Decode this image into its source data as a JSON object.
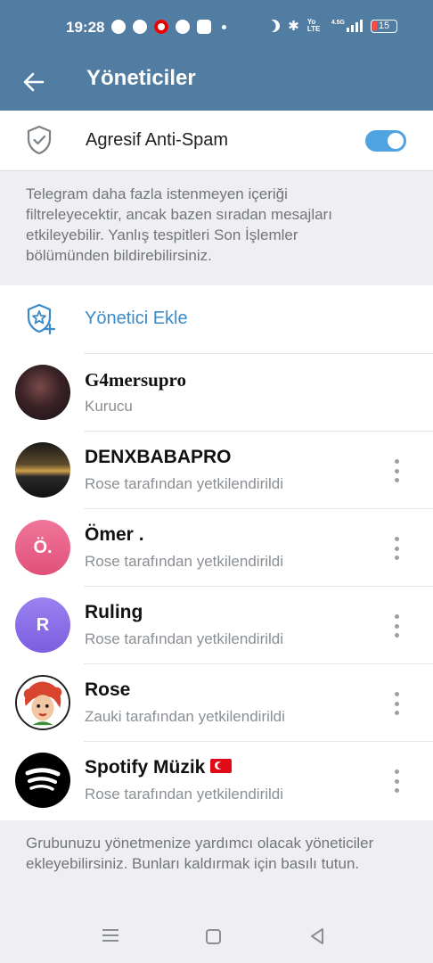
{
  "status_bar": {
    "time": "19:28",
    "network_label": "Yo LTE",
    "net_speed": "4.5G",
    "battery": "15"
  },
  "toolbar": {
    "title": "Yöneticiler"
  },
  "antispam": {
    "label": "Agresif Anti-Spam",
    "enabled": true,
    "description": "Telegram daha fazla istenmeyen içeriği filtreleyecektir, ancak bazen sıradan mesajları etkileyebilir. Yanlış tespitleri Son İşlemler bölümünden bildirebilirsiniz."
  },
  "add_admin": {
    "label": "Yönetici Ekle"
  },
  "admins": [
    {
      "name": "G4mersupro",
      "role": "Kurucu",
      "avatar": "photo-dark",
      "initial": ""
    },
    {
      "name": "DENXBABAPRO",
      "role": "Rose tarafından yetkilendirildi",
      "avatar": "photo-car",
      "initial": ""
    },
    {
      "name": "Ömer .",
      "role": "Rose tarafından yetkilendirildi",
      "avatar": "initial-pink",
      "initial": "Ö."
    },
    {
      "name": "Ruling",
      "role": "Rose tarafından yetkilendirildi",
      "avatar": "initial-purple",
      "initial": "R"
    },
    {
      "name": "Rose",
      "role": "Zauki tarafından yetkilendirildi",
      "avatar": "photo-redhead",
      "initial": ""
    },
    {
      "name": "Spotify Müzik",
      "role": "Rose tarafından yetkilendirildi",
      "avatar": "spotify-logo",
      "initial": "",
      "flag": "turkey-flag"
    }
  ],
  "footer_text": "Grubunuzu yönetmenize yardımcı olacak yöneticiler ekleyebilirsiniz. Bunları kaldırmak için basılı tutun.",
  "colors": {
    "header": "#517da2",
    "accent": "#3a8bca",
    "toggle": "#4fa3e0",
    "pink_avatar": "#e8587a",
    "purple_avatar": "#8b6fe8"
  }
}
